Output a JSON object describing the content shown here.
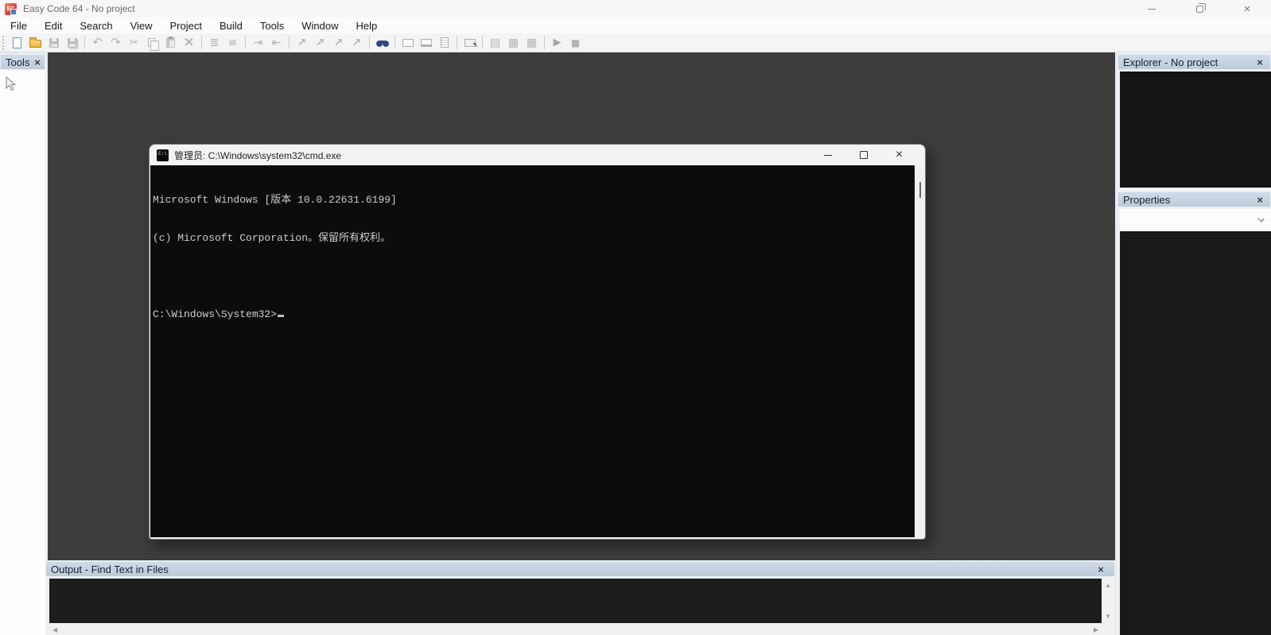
{
  "window": {
    "title": "Easy Code 64 - No project",
    "controls": [
      "minimize",
      "restore",
      "close"
    ]
  },
  "menu": {
    "items": [
      "File",
      "Edit",
      "Search",
      "View",
      "Project",
      "Build",
      "Tools",
      "Window",
      "Help"
    ]
  },
  "toolbar": {
    "groups": [
      [
        {
          "name": "new-file",
          "enabled": true
        },
        {
          "name": "open-file",
          "enabled": true
        },
        {
          "name": "save",
          "enabled": false
        },
        {
          "name": "save-all",
          "enabled": false
        }
      ],
      [
        {
          "name": "undo",
          "enabled": false
        },
        {
          "name": "redo",
          "enabled": false
        },
        {
          "name": "cut",
          "enabled": false
        },
        {
          "name": "copy",
          "enabled": false
        },
        {
          "name": "paste",
          "enabled": false
        },
        {
          "name": "delete",
          "enabled": false
        }
      ],
      [
        {
          "name": "bookmark-toggle",
          "enabled": false
        },
        {
          "name": "bookmark-clear",
          "enabled": false
        }
      ],
      [
        {
          "name": "indent-increase",
          "enabled": false
        },
        {
          "name": "indent-decrease",
          "enabled": false
        }
      ],
      [
        {
          "name": "comment-add",
          "enabled": false
        },
        {
          "name": "comment-toggle",
          "enabled": false
        },
        {
          "name": "uncomment",
          "enabled": false
        },
        {
          "name": "comment-remove",
          "enabled": false
        }
      ],
      [
        {
          "name": "find-in-files",
          "enabled": true
        }
      ],
      [
        {
          "name": "new-dialog",
          "enabled": false
        },
        {
          "name": "new-window",
          "enabled": false
        },
        {
          "name": "view-document",
          "enabled": false
        }
      ],
      [
        {
          "name": "properties",
          "enabled": false
        }
      ],
      [
        {
          "name": "build-link",
          "enabled": false
        },
        {
          "name": "assemble",
          "enabled": false
        },
        {
          "name": "build",
          "enabled": false
        }
      ],
      [
        {
          "name": "run",
          "enabled": false
        },
        {
          "name": "stop",
          "enabled": false
        }
      ]
    ]
  },
  "panels": {
    "tools": {
      "title": "Tools"
    },
    "explorer": {
      "title": "Explorer - No project"
    },
    "properties": {
      "title": "Properties",
      "selector_value": ""
    },
    "output": {
      "title": "Output - Find Text in Files"
    }
  },
  "terminal": {
    "title": "管理员: C:\\Windows\\system32\\cmd.exe",
    "lines": [
      "Microsoft Windows [版本 10.0.22631.6199]",
      "(c) Microsoft Corporation。保留所有权利。",
      "",
      "C:\\Windows\\System32>"
    ]
  },
  "colors": {
    "panel_header_bg": "#c4d1df",
    "workspace_bg": "#3d3d3d",
    "console_bg": "#0c0c0c",
    "console_fg": "#cccccc",
    "dock_bg": "#e9edf3",
    "find_icon_blue": "#27477e"
  }
}
